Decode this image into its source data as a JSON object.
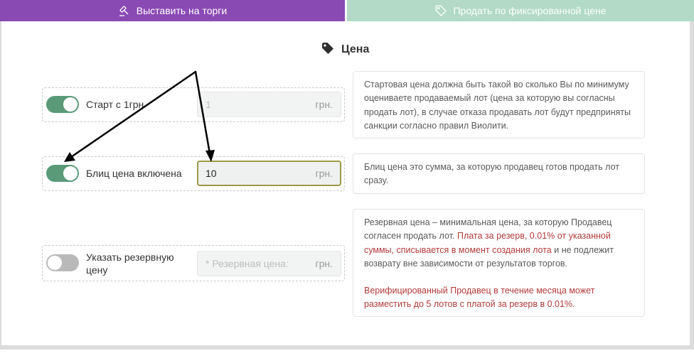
{
  "tabs": {
    "auction": "Выставить на торги",
    "fixed": "Продать по фиксированной цене"
  },
  "section": {
    "title": "Цена"
  },
  "start": {
    "label": "Старт с 1грн",
    "value": "1",
    "unit": "грн.",
    "enabled": true,
    "info": "Стартовая цена должна быть такой во сколько Вы по минимуму оцениваете продаваемый лот (цена за которую вы согласны продать лот), в случае отказа продавать лот будут предприняты санкции согласно правил Виолити."
  },
  "blitz": {
    "label": "Блиц цена включена",
    "value": "10",
    "unit": "грн.",
    "enabled": true,
    "info": "Блиц цена это сумма, за которую продавец готов продать лот сразу."
  },
  "reserve": {
    "label_line1": "Указать резервную",
    "label_line2": "цену",
    "placeholder": "* Резервная цена:",
    "unit": "грн.",
    "enabled": false,
    "info_part1": "Резервная цена – минимальная цена, за которую Продавец согласен продать лот.",
    "info_red1": "Плата за резерв, 0.01% от указанной суммы, списывается в момент создания лота",
    "info_part2": "и не подлежит возврату вне зависимости от результатов торгов.",
    "info_red2": "Верифицированный Продавец в течение месяца может разместить до 5 лотов с платой за резерв в 0.01%."
  },
  "colors": {
    "tab_auction": "#8a4ab4",
    "tab_fixed": "#b2dac7",
    "toggle_on": "#5a9a78",
    "toggle_off": "#b9b9b9",
    "warning_text": "#b33a3a",
    "active_border": "#9c9a46"
  },
  "icons": {
    "auction_tab": "gavel-icon",
    "fixed_tab": "tag-icon",
    "section": "tag-icon"
  }
}
